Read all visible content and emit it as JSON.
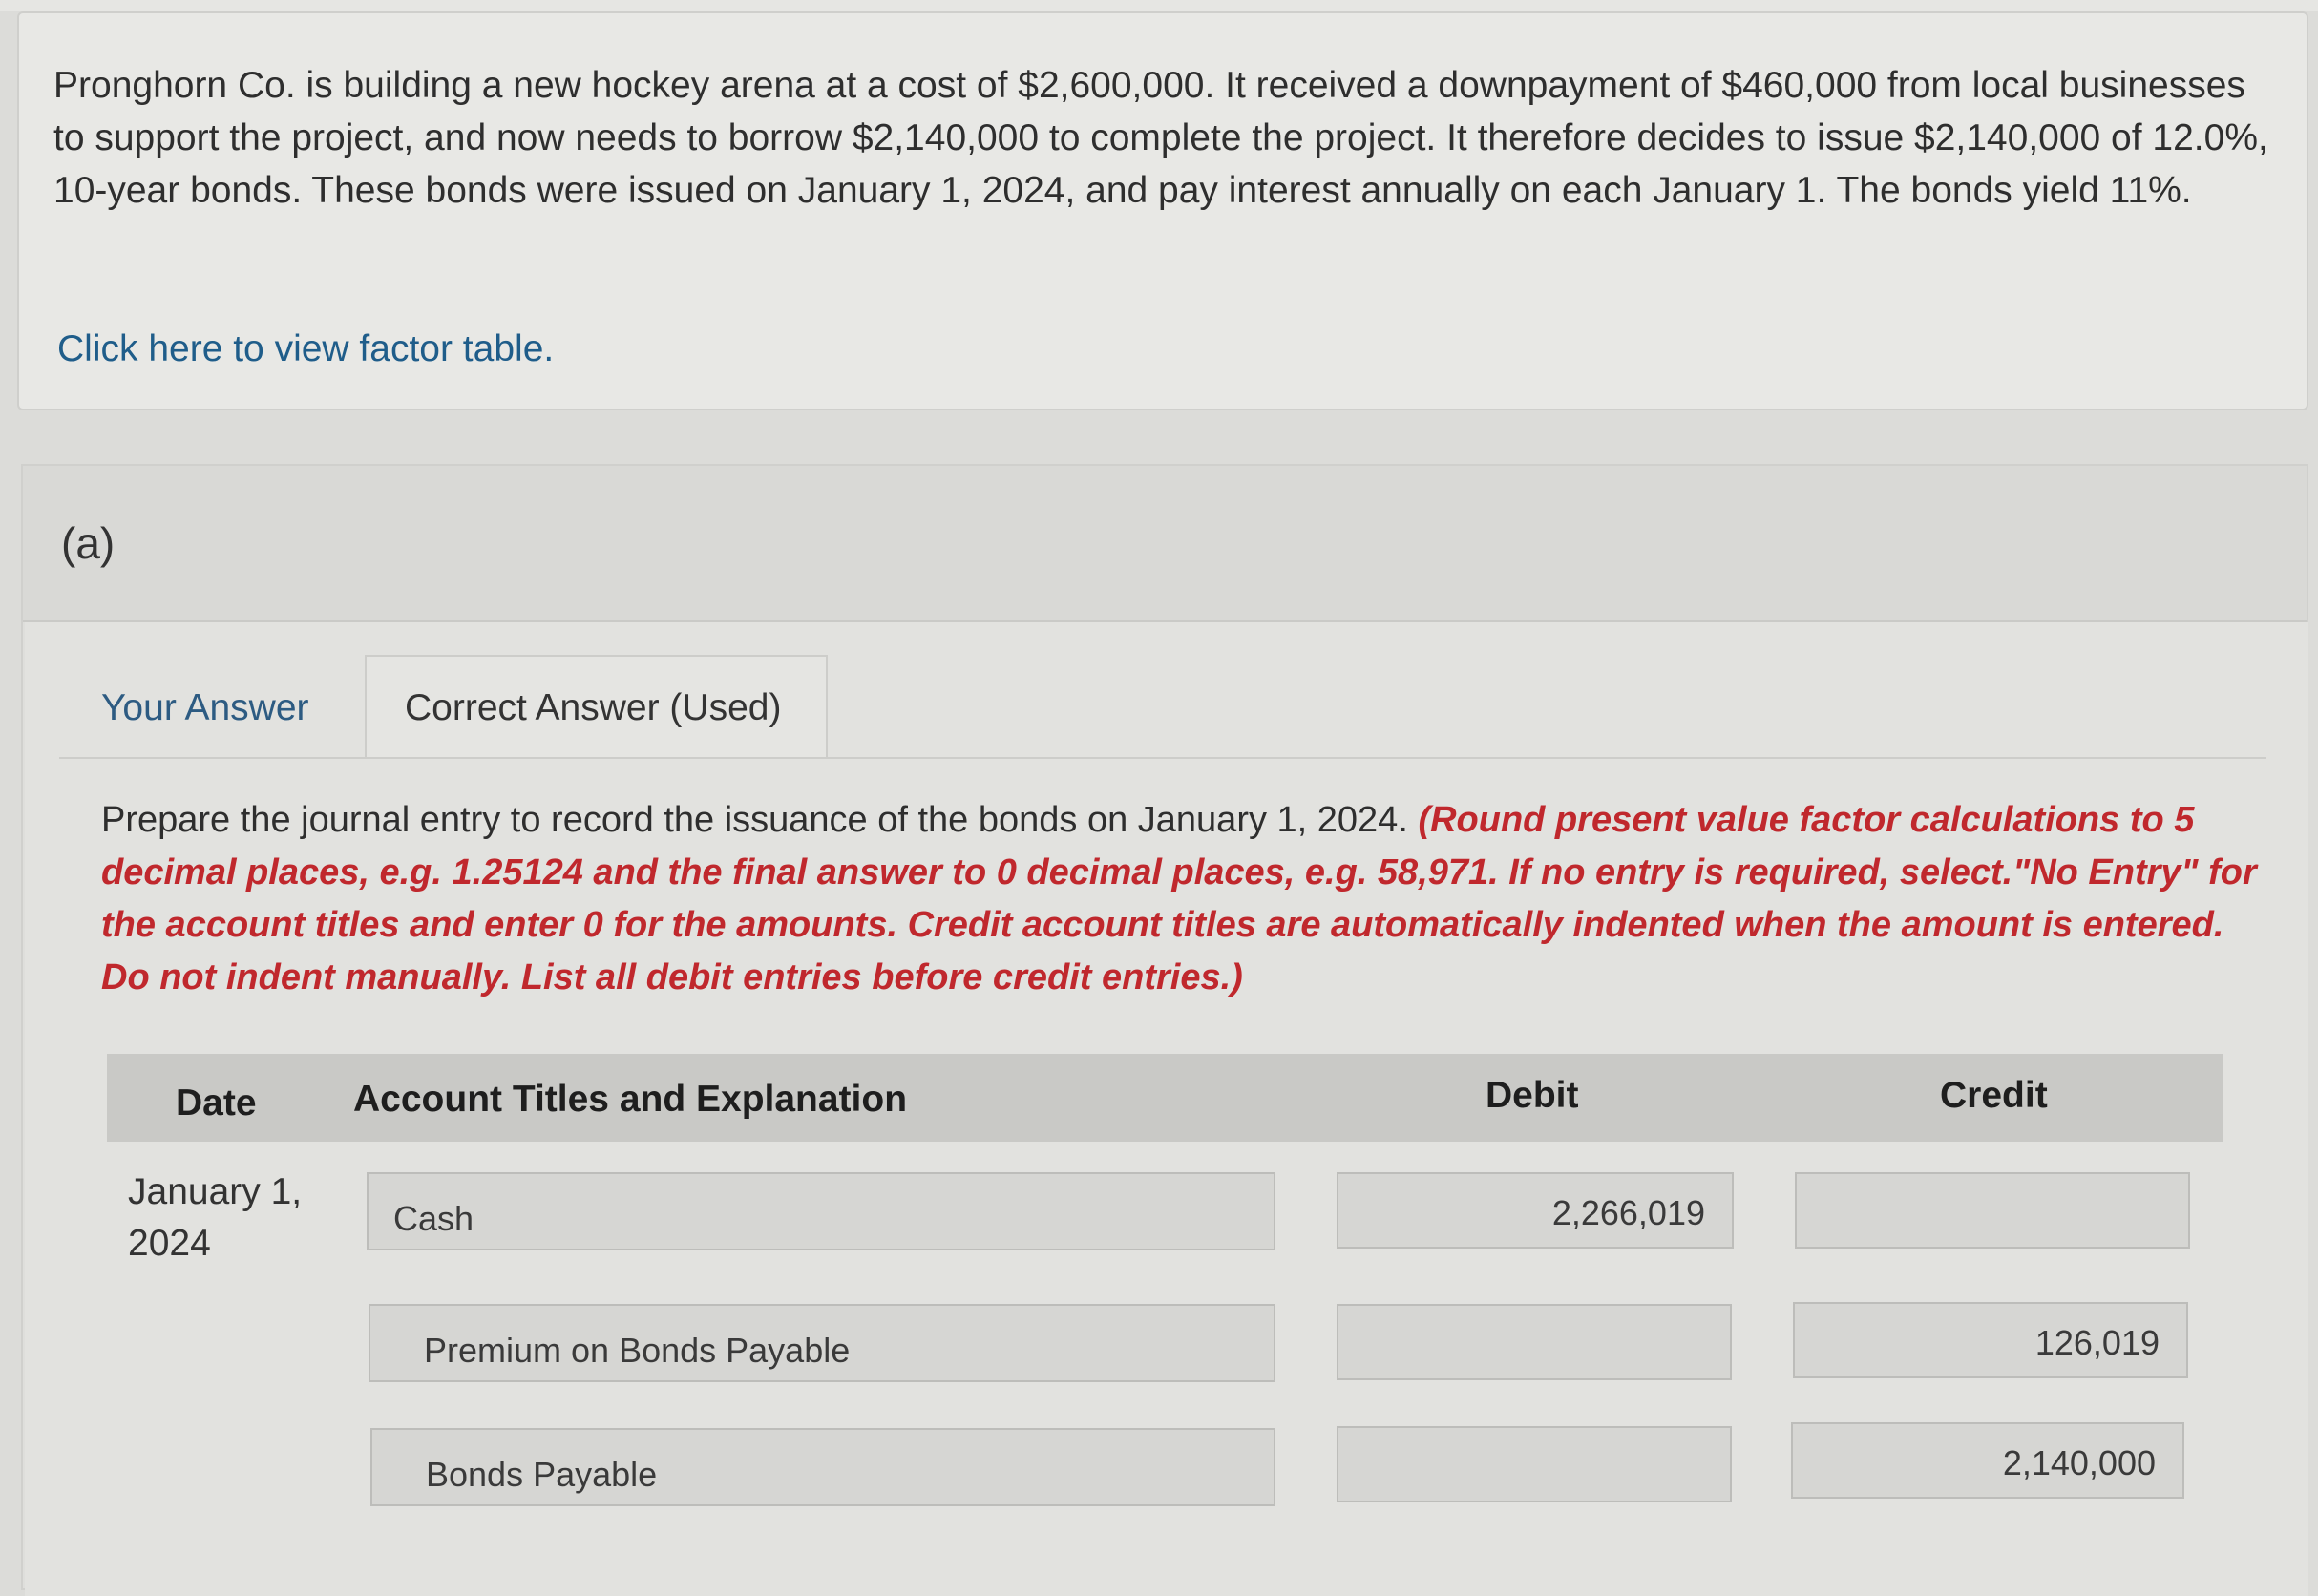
{
  "problem": {
    "text": "Pronghorn Co. is building a new hockey arena at a cost of $2,600,000. It received a downpayment of $460,000 from local businesses to support the project, and now needs to borrow $2,140,000 to complete the project. It therefore decides to issue $2,140,000 of 12.0%, 10-year bonds. These bonds were issued on January 1, 2024, and pay interest annually on each January 1. The bonds yield 11%.",
    "factor_link": "Click here to view factor table."
  },
  "part": {
    "label": "(a)",
    "tabs": [
      {
        "label": "Your Answer"
      },
      {
        "label": "Correct Answer (Used)"
      }
    ],
    "instruction": "Prepare the journal entry to record the issuance of the bonds on January 1, 2024.",
    "instruction_red": "(Round present value factor calculations to 5 decimal places, e.g. 1.25124 and the final answer to 0 decimal places, e.g. 58,971. If no entry is required, select.\"No Entry\" for the account titles and enter 0 for the amounts. Credit account titles are automatically indented when the amount is entered. Do not indent manually. List all debit entries before credit entries.)"
  },
  "table": {
    "headers": {
      "date": "Date",
      "account": "Account Titles and Explanation",
      "debit": "Debit",
      "credit": "Credit"
    },
    "date_line1": "January 1,",
    "date_line2": "2024",
    "rows": [
      {
        "account": "Cash",
        "debit": "2,266,019",
        "credit": ""
      },
      {
        "account": "Premium on Bonds Payable",
        "debit": "",
        "credit": "126,019"
      },
      {
        "account": "Bonds Payable",
        "debit": "",
        "credit": "2,140,000"
      }
    ]
  }
}
